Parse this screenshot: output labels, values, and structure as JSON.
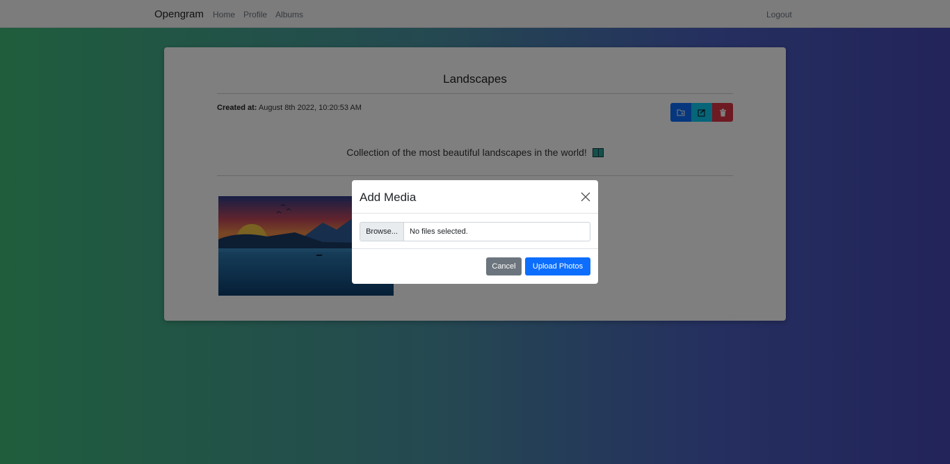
{
  "navbar": {
    "brand": "Opengram",
    "links": [
      "Home",
      "Profile",
      "Albums"
    ],
    "logout": "Logout"
  },
  "album": {
    "title": "Landscapes",
    "created_label": "Created at:",
    "created_value": "August 8th 2022, 10:20:53 AM",
    "description": "Collection of the most beautiful landscapes in the world!",
    "actions": {
      "add_media_icon": "folder-plus-icon",
      "edit_icon": "edit-icon",
      "delete_icon": "trash-icon"
    },
    "colors": {
      "add": "#0d6efd",
      "edit": "#0dcaf0",
      "delete": "#dc3545"
    }
  },
  "modal": {
    "title": "Add Media",
    "browse_label": "Browse...",
    "file_status": "No files selected.",
    "cancel_label": "Cancel",
    "upload_label": "Upload Photos"
  }
}
